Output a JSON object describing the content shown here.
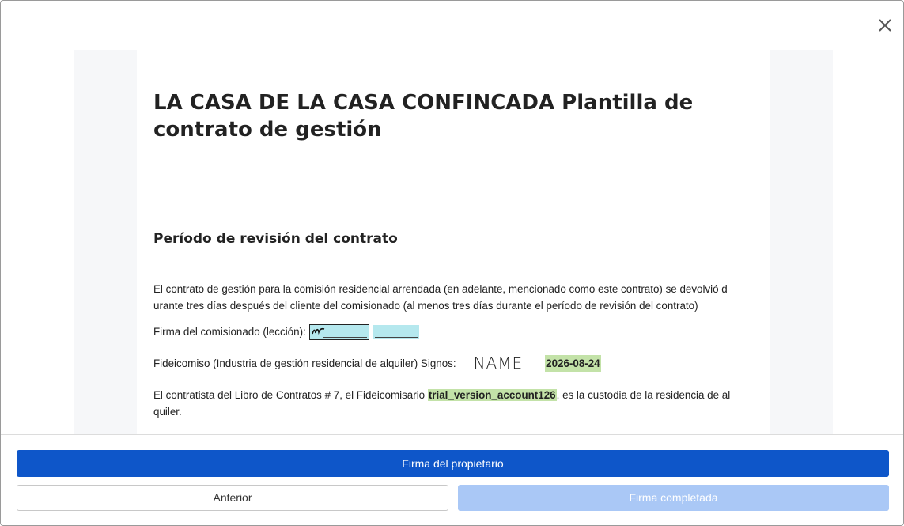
{
  "document": {
    "title": "LA CASA DE LA CASA CONFINCADA Plantilla de contrato de gestión",
    "section_heading": "Período de revisión del contrato",
    "paragraph_1": "El contrato de gestión para la comisión residencial arrendada (en adelante, mencionado como este contrato) se devolvió d urante tres días después del cliente del comisionado (al menos tres días durante el período de revisión del contrato)",
    "sign_label": "Firma del comisionado (lección):",
    "trust_label": "Fideicomiso (Industria de gestión residencial de alquiler) Signos:",
    "trust_signature": "NAME",
    "trust_date": "2026-08-24",
    "paragraph_3_before": "El contratista del Libro de Contratos # 7, el Fideicomisario ",
    "paragraph_3_account": "trial_version_account126",
    "paragraph_3_after": ", es la custodia de la residencia de al quiler."
  },
  "footer": {
    "primary_button": "Firma del propietario",
    "previous_button": "Anterior",
    "completed_button": "Firma completada"
  },
  "colors": {
    "primary": "#0e56c9",
    "disabled": "#aac8f6",
    "signature_field": "#b5e8ee",
    "highlight": "#c3e2a8"
  },
  "icons": {
    "close": "close-icon"
  }
}
